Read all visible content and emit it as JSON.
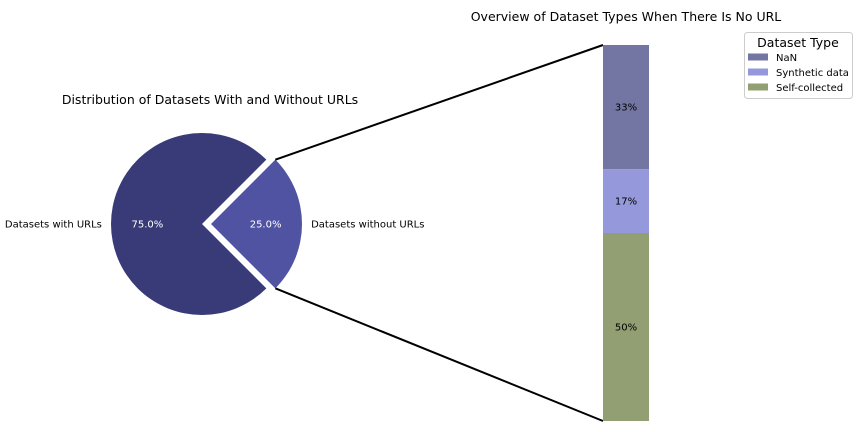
{
  "chart_data": [
    {
      "type": "pie",
      "title": "Distribution of Datasets With and Without URLs",
      "categories": [
        "Datasets with URLs",
        "Datasets without URLs"
      ],
      "values": [
        75.0,
        25.0
      ],
      "value_labels": [
        "75.0%",
        "25.0%"
      ],
      "colors": [
        "#383b77",
        "#5052a2"
      ],
      "exploded": "Datasets without URLs"
    },
    {
      "type": "bar",
      "stacked": true,
      "title": "Overview of Dataset Types When There Is No URL",
      "categories": [
        "NaN",
        "Synthetic data",
        "Self-collected"
      ],
      "values": [
        33,
        17,
        50
      ],
      "value_labels": [
        "33%",
        "17%",
        "50%"
      ],
      "colors": [
        "#7376a2",
        "#9598da",
        "#919f72"
      ],
      "legend": {
        "title": "Dataset Type",
        "placement": "top-right",
        "entries": [
          "NaN",
          "Synthetic data",
          "Self-collected"
        ]
      }
    }
  ]
}
